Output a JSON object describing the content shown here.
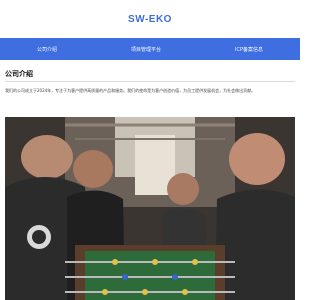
{
  "site": {
    "title": "SW-EKO"
  },
  "nav": {
    "items": [
      "公司介绍",
      "项目管理平台",
      "ICP备案信息"
    ]
  },
  "about": {
    "heading": "公司介绍",
    "body": "我们的公司成立于2024年，专注于为客户提供高质量的产品和服务。我们的使命是为客户创造价值，为员工提供发展机会，为社会做出贡献。"
  },
  "colors": {
    "brand": "#3e6ee0",
    "title": "#3d6fd8"
  },
  "photo": {
    "subject": "people playing foosball"
  }
}
